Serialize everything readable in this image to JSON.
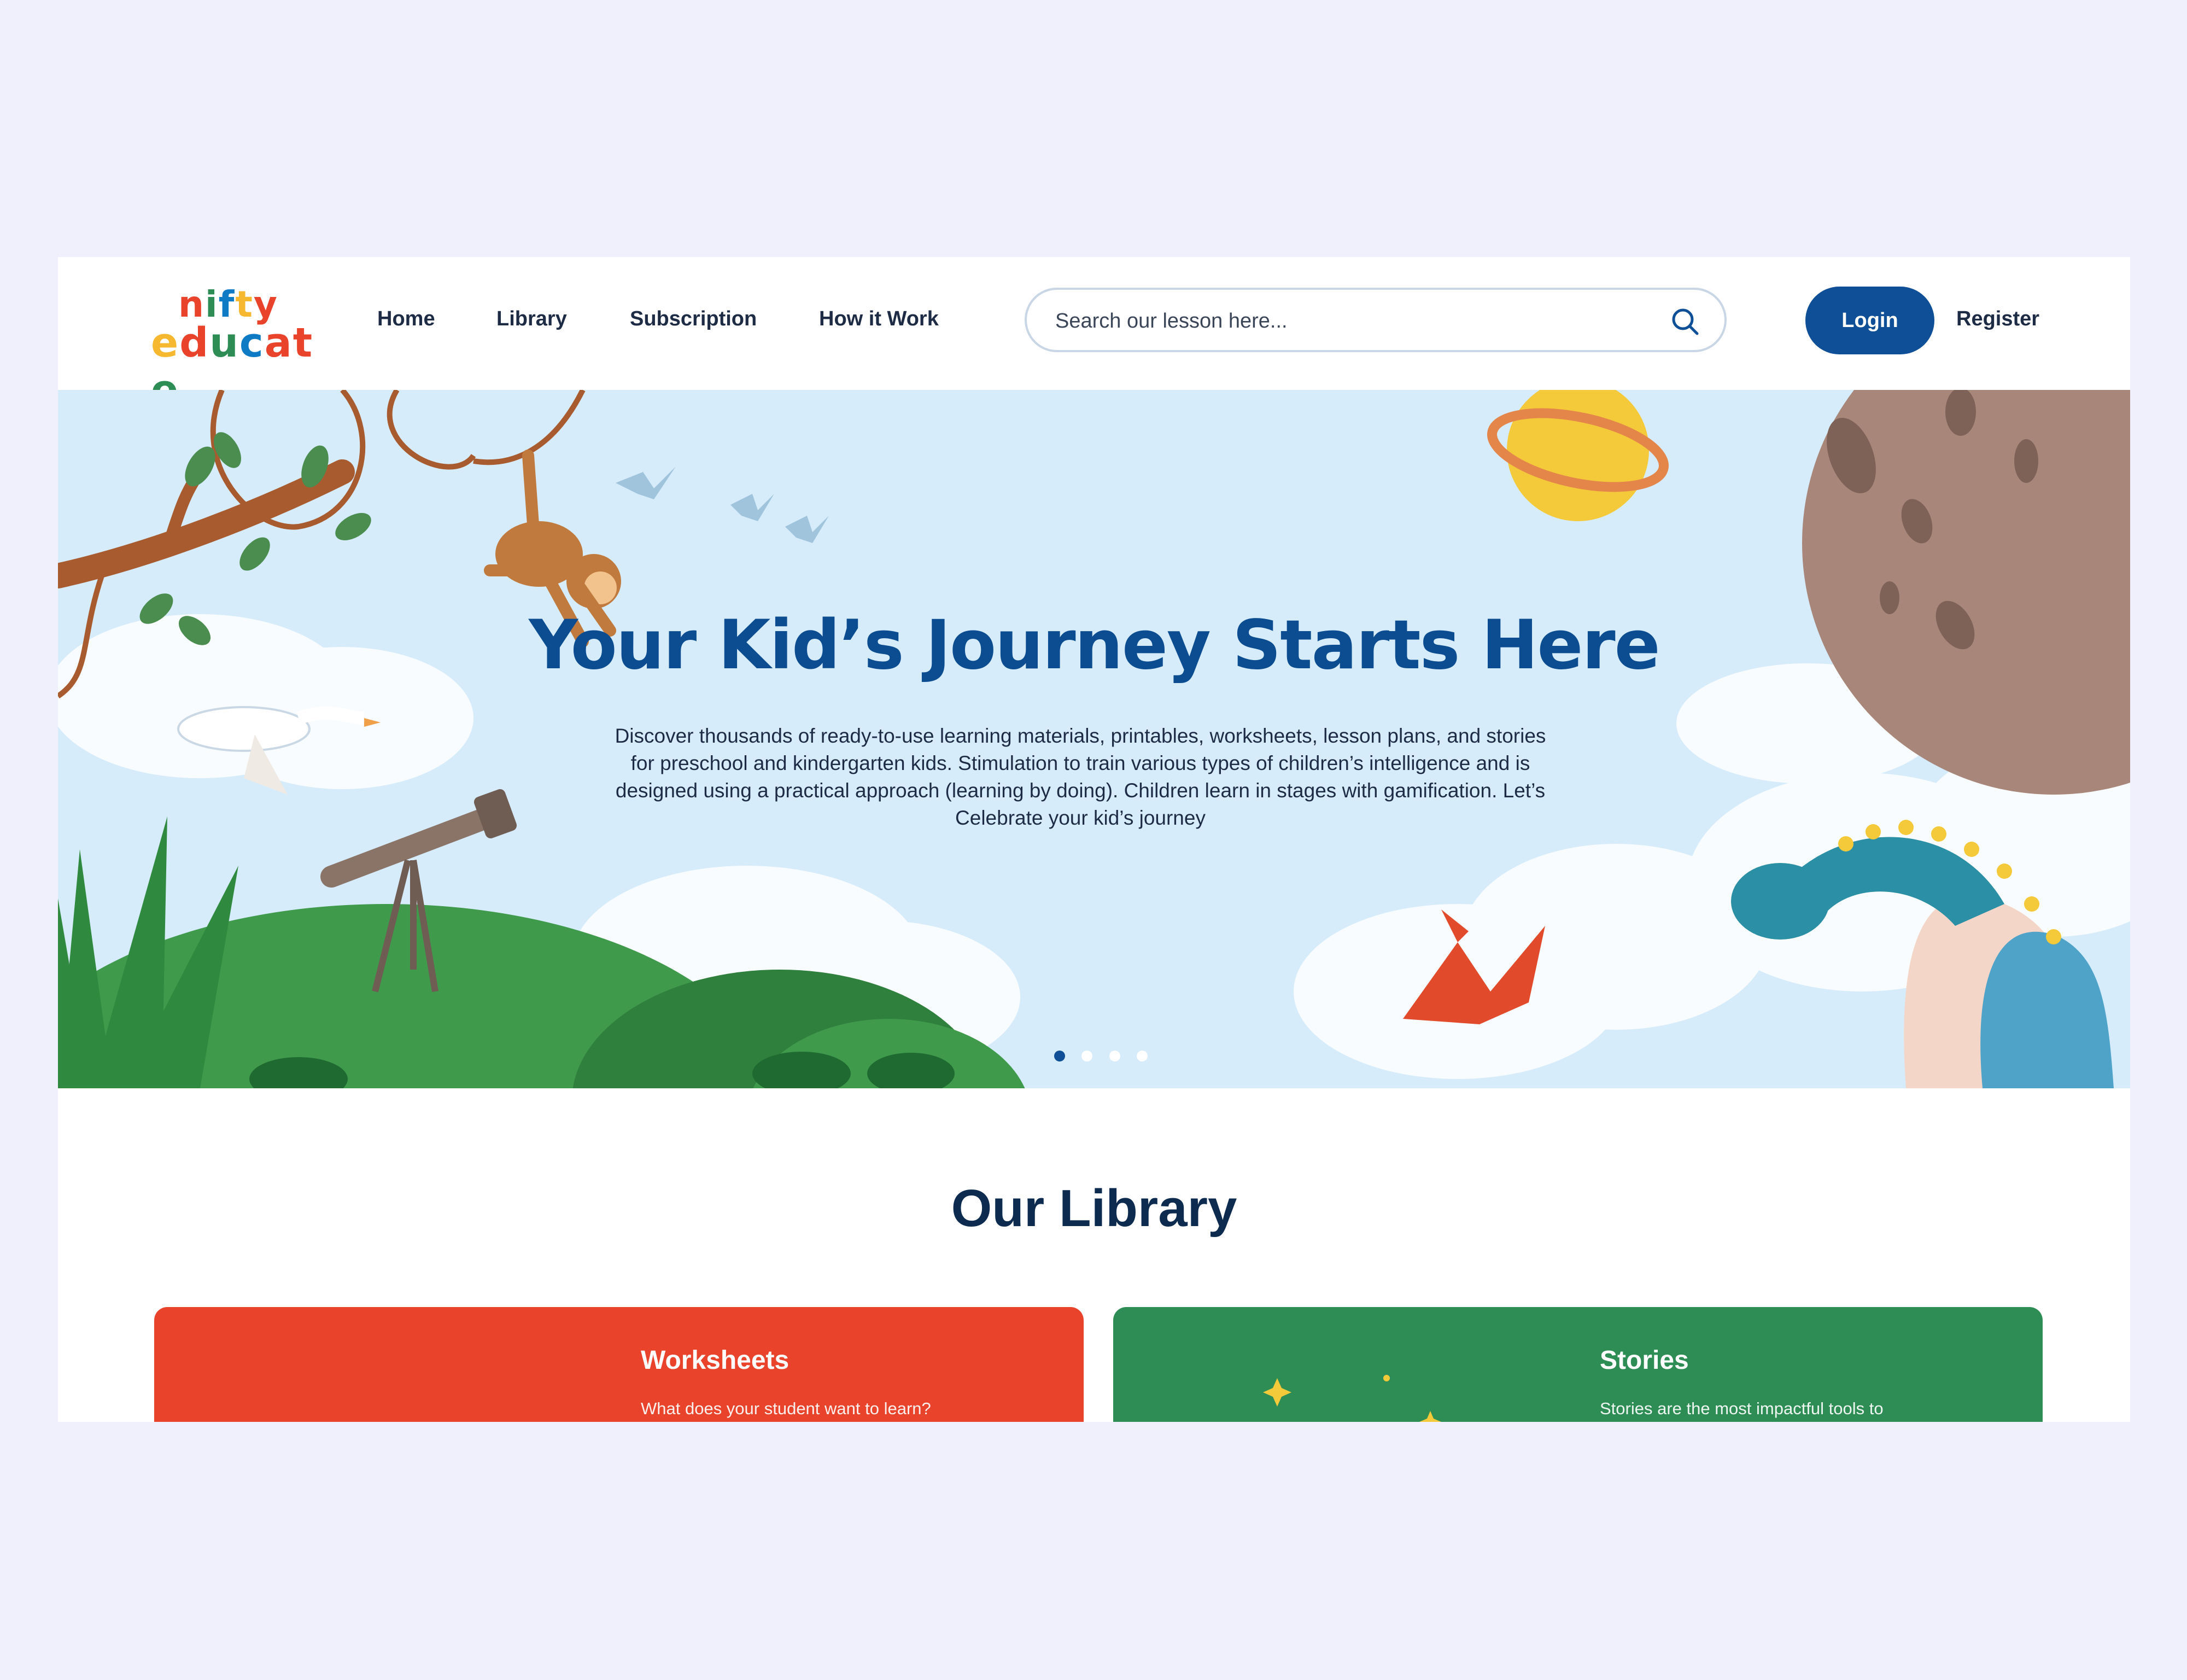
{
  "brand": {
    "logo_line1": "nifty",
    "logo_line2": "educate",
    "colors": [
      "#e9432c",
      "#2e8d55",
      "#0e7bc4",
      "#f5b82e",
      "#e9432c",
      "#2e8d55",
      "#0e7bc4",
      "#e9432c"
    ]
  },
  "nav": {
    "items": [
      {
        "label": "Home"
      },
      {
        "label": "Library"
      },
      {
        "label": "Subscription"
      },
      {
        "label": "How it Work"
      }
    ]
  },
  "search": {
    "placeholder": "Search our lesson here...",
    "icon": "search-icon"
  },
  "auth": {
    "login_label": "Login",
    "register_label": "Register"
  },
  "hero": {
    "title": "Your Kid’s Journey Starts Here",
    "description": "Discover thousands of ready-to-use learning materials, printables, worksheets, lesson plans, and stories for preschool and kindergarten kids. Stimulation to train various types of children’s intelligence and is designed using a practical approach (learning by doing). Children learn in stages with gamification. Let’s Celebrate your kid’s journey",
    "slides_total": 4,
    "active_slide": 1
  },
  "library": {
    "title": "Our Library",
    "cards": [
      {
        "title": "Worksheets",
        "subtitle": "What does your student want to learn?",
        "color": "#e9432c"
      },
      {
        "title": "Stories",
        "subtitle": "Stories are the most impactful tools to",
        "color": "#2e8d55"
      }
    ]
  },
  "colors": {
    "primary": "#0e4f97",
    "page_bg": "#eff0fb",
    "hero_bg": "#d6ecfb"
  }
}
